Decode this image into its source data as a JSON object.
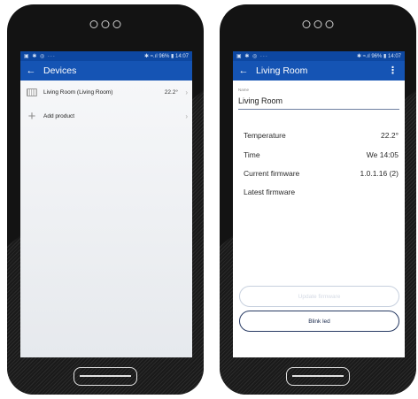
{
  "left_phone": {
    "status": {
      "left_icons": "▣ ✱ ◎ ···",
      "right_text": "✱ ≈.ıl 96% ▮ 14:07"
    },
    "appbar": {
      "back_glyph": "←",
      "title": "Devices"
    },
    "rows": [
      {
        "label": "Living Room (Living Room)",
        "value": "22.2°",
        "icon": "thermostat-device-icon"
      },
      {
        "label": "Add product",
        "value": "",
        "icon": "plus-icon"
      }
    ],
    "chevron": "›"
  },
  "right_phone": {
    "status": {
      "left_icons": "▣ ✱ ◎ ···",
      "right_text": "✱ ≈.ıl 96% ▮ 14:07"
    },
    "appbar": {
      "back_glyph": "←",
      "title": "Living Room",
      "menu_glyph": "⋮"
    },
    "name_field": {
      "label": "Name",
      "value": "Living Room"
    },
    "info": [
      {
        "label": "Temperature",
        "value": "22.2°"
      },
      {
        "label": "Time",
        "value": "We 14:05"
      },
      {
        "label": "Current firmware",
        "value": "1.0.1.16 (2)"
      },
      {
        "label": "Latest firmware",
        "value": ""
      }
    ],
    "buttons": {
      "update": "Update firmware",
      "blink": "Blink led"
    }
  },
  "colors": {
    "status_bar": "#0d47a1",
    "app_bar": "#1554b4",
    "phone_body": "#131313"
  }
}
